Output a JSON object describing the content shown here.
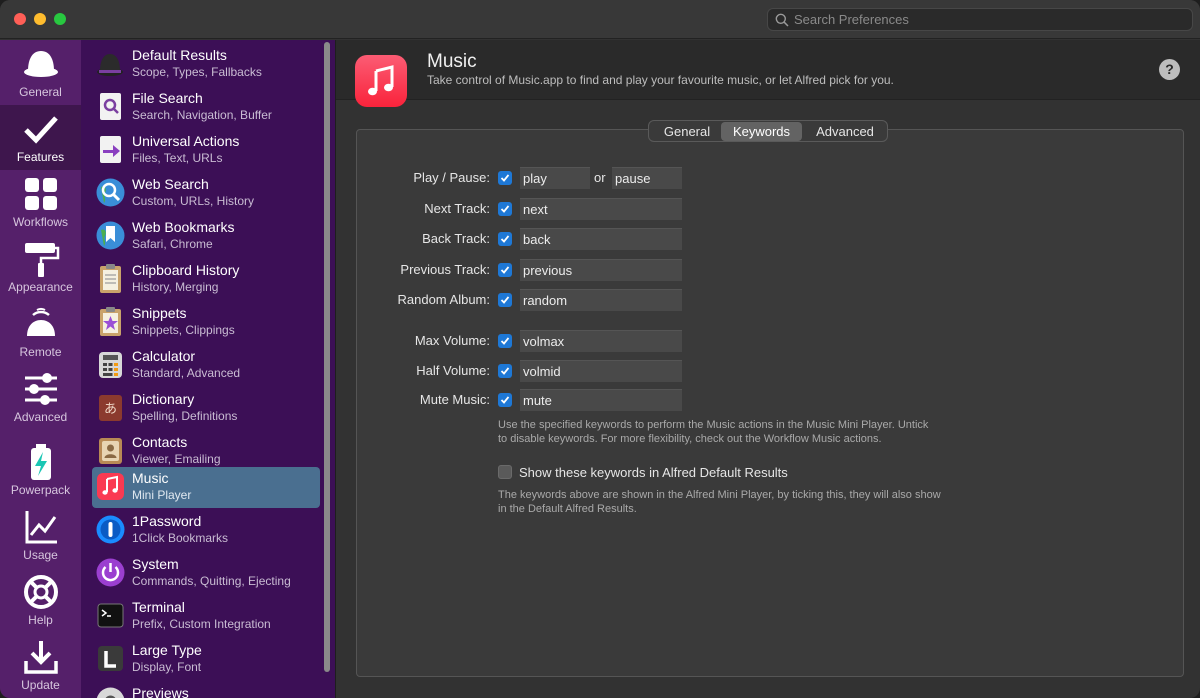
{
  "search": {
    "placeholder": "Search Preferences"
  },
  "rail": [
    {
      "label": "General",
      "icon": "hat-icon"
    },
    {
      "label": "Features",
      "icon": "checkmark-icon"
    },
    {
      "label": "Workflows",
      "icon": "grid-icon"
    },
    {
      "label": "Appearance",
      "icon": "paint-roller-icon"
    },
    {
      "label": "Remote",
      "icon": "remote-icon"
    },
    {
      "label": "Advanced",
      "icon": "sliders-icon"
    },
    {
      "label": "Powerpack",
      "icon": "battery-icon"
    },
    {
      "label": "Usage",
      "icon": "chart-icon"
    },
    {
      "label": "Help",
      "icon": "lifebuoy-icon"
    },
    {
      "label": "Update",
      "icon": "download-icon"
    }
  ],
  "features": [
    {
      "title": "Default Results",
      "sub": "Scope, Types, Fallbacks"
    },
    {
      "title": "File Search",
      "sub": "Search, Navigation, Buffer"
    },
    {
      "title": "Universal Actions",
      "sub": "Files, Text, URLs"
    },
    {
      "title": "Web Search",
      "sub": "Custom, URLs, History"
    },
    {
      "title": "Web Bookmarks",
      "sub": "Safari, Chrome"
    },
    {
      "title": "Clipboard History",
      "sub": "History, Merging"
    },
    {
      "title": "Snippets",
      "sub": "Snippets, Clippings"
    },
    {
      "title": "Calculator",
      "sub": "Standard, Advanced"
    },
    {
      "title": "Dictionary",
      "sub": "Spelling, Definitions"
    },
    {
      "title": "Contacts",
      "sub": "Viewer, Emailing"
    },
    {
      "title": "Music",
      "sub": "Mini Player"
    },
    {
      "title": "1Password",
      "sub": "1Click Bookmarks"
    },
    {
      "title": "System",
      "sub": "Commands, Quitting, Ejecting"
    },
    {
      "title": "Terminal",
      "sub": "Prefix, Custom Integration"
    },
    {
      "title": "Large Type",
      "sub": "Display, Font"
    },
    {
      "title": "Previews",
      "sub": ""
    }
  ],
  "header": {
    "title": "Music",
    "description": "Take control of Music.app to find and play your favourite music, or let Alfred pick for you.",
    "help": "?"
  },
  "tabs": [
    "General",
    "Keywords",
    "Advanced"
  ],
  "keywords": {
    "play_pause_label": "Play / Pause:",
    "play": "play",
    "or": "or",
    "pause": "pause",
    "rows": [
      {
        "label": "Next Track:",
        "value": "next"
      },
      {
        "label": "Back Track:",
        "value": "back"
      },
      {
        "label": "Previous Track:",
        "value": "previous"
      },
      {
        "label": "Random Album:",
        "value": "random"
      },
      {
        "label": "Max Volume:",
        "value": "volmax"
      },
      {
        "label": "Half Volume:",
        "value": "volmid"
      },
      {
        "label": "Mute Music:",
        "value": "mute"
      }
    ],
    "note1_line1": "Use the specified keywords to perform the Music actions in the Music Mini Player. Untick",
    "note1_line2": "to disable keywords. For more flexibility, check out the Workflow Music actions.",
    "show_label": "Show these keywords in Alfred Default Results",
    "note2_line1": "The keywords above are shown in the Alfred Mini Player, by ticking this, they will also show",
    "note2_line2": "in the Default Alfred Results."
  }
}
